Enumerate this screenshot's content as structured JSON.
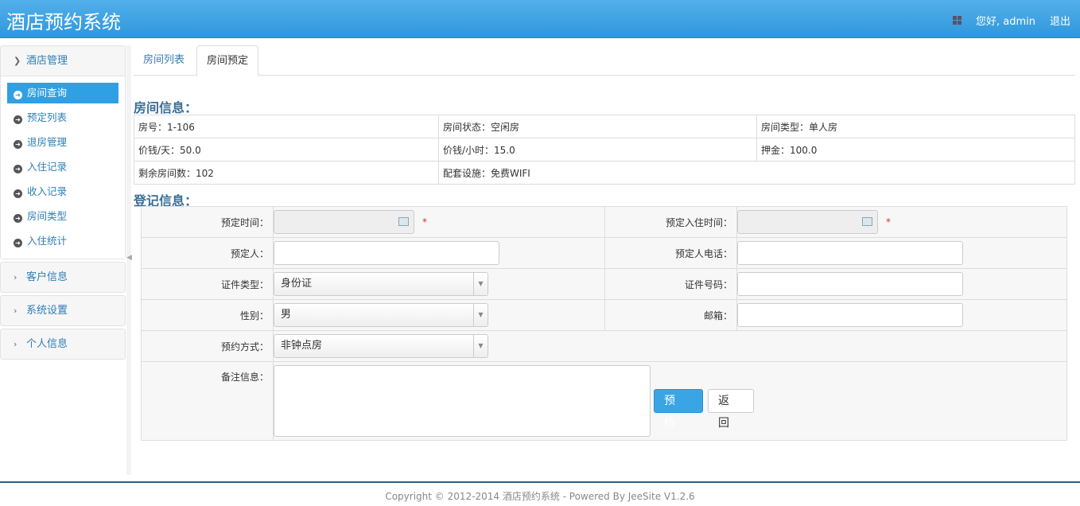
{
  "header": {
    "title": "酒店预约系统",
    "greeting": "您好, admin",
    "logout": "退出"
  },
  "sidebar": {
    "groups": [
      {
        "label": "酒店管理",
        "items": [
          "房间查询",
          "预定列表",
          "退房管理",
          "入住记录",
          "收入记录",
          "房间类型",
          "入住统计"
        ]
      },
      {
        "label": "客户信息"
      },
      {
        "label": "系统设置"
      },
      {
        "label": "个人信息"
      }
    ]
  },
  "tabs": [
    "房间列表",
    "房间预定"
  ],
  "room_section": "房间信息：",
  "room": [
    [
      "房号：1-106",
      "房间状态：空闲房",
      "房间类型：单人房"
    ],
    [
      "价钱/天：50.0",
      "价钱/小时：15.0",
      "押金：100.0"
    ],
    [
      "剩余房间数：102",
      "配套设施：免费WIFI"
    ]
  ],
  "reg_section": "登记信息：",
  "form": {
    "book_time": "预定时间：",
    "checkin_time": "预定入住时间：",
    "booker": "预定人：",
    "phone": "预定人电话：",
    "id_type": "证件类型：",
    "id_type_value": "身份证",
    "id_no": "证件号码：",
    "gender": "性别：",
    "gender_value": "男",
    "email": "邮箱：",
    "method": "预约方式：",
    "method_value": "非钟点房",
    "remark": "备注信息：",
    "required": "*",
    "submit": "预 约",
    "back": "返 回"
  },
  "footer": "Copyright © 2012-2014 酒店预约系统 - Powered By JeeSite V1.2.6"
}
